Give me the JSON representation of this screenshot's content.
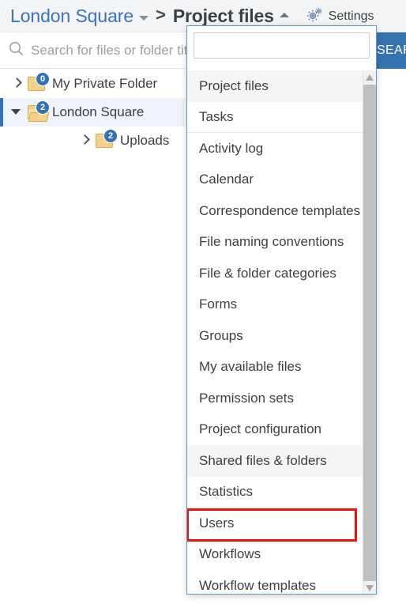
{
  "breadcrumb": {
    "root_label": "London Square",
    "separator": ">",
    "current_label": "Project files",
    "root_caret_icon": "chevron-down-icon",
    "current_caret_icon": "chevron-up-icon"
  },
  "settings": {
    "label": "Settings",
    "icon": "gears-icon"
  },
  "search": {
    "placeholder": "Search for files or folder titles",
    "value": "",
    "icon": "search-icon",
    "button_label": "SEARCH",
    "button_color": "#3573b0"
  },
  "tree": {
    "items": [
      {
        "label": "My Private Folder",
        "badge": "0",
        "expanded": false,
        "selected": false,
        "indent": 0,
        "folder_icon": "folder-closed-icon",
        "arrow_icon": "chevron-right-icon"
      },
      {
        "label": "London Square",
        "badge": "2",
        "expanded": true,
        "selected": true,
        "indent": 0,
        "folder_icon": "folder-open-icon",
        "arrow_icon": "caret-down-icon"
      },
      {
        "label": "Uploads",
        "badge": "2",
        "expanded": false,
        "selected": false,
        "indent": 1,
        "folder_icon": "folder-closed-icon",
        "arrow_icon": "chevron-right-icon"
      }
    ]
  },
  "dropdown": {
    "filter_value": "",
    "filter_placeholder": "",
    "scrollbar": {
      "up_icon": "scroll-up-arrow-icon",
      "down_icon": "scroll-down-arrow-icon"
    },
    "highlight_color": "#ee1111",
    "items": [
      {
        "label": "Project files",
        "state": "hover",
        "divider_after": false,
        "marked": false
      },
      {
        "label": "Tasks",
        "state": "normal",
        "divider_after": true,
        "marked": false
      },
      {
        "label": "Activity log",
        "state": "normal",
        "divider_after": false,
        "marked": false
      },
      {
        "label": "Calendar",
        "state": "normal",
        "divider_after": false,
        "marked": false
      },
      {
        "label": "Correspondence templates",
        "state": "normal",
        "divider_after": false,
        "marked": false
      },
      {
        "label": "File naming conventions",
        "state": "normal",
        "divider_after": false,
        "marked": false
      },
      {
        "label": "File & folder categories",
        "state": "normal",
        "divider_after": false,
        "marked": false
      },
      {
        "label": "Forms",
        "state": "normal",
        "divider_after": false,
        "marked": false
      },
      {
        "label": "Groups",
        "state": "normal",
        "divider_after": false,
        "marked": false
      },
      {
        "label": "My available files",
        "state": "normal",
        "divider_after": false,
        "marked": false
      },
      {
        "label": "Permission sets",
        "state": "normal",
        "divider_after": false,
        "marked": false
      },
      {
        "label": "Project configuration",
        "state": "normal",
        "divider_after": false,
        "marked": false
      },
      {
        "label": "Shared files & folders",
        "state": "hover",
        "divider_after": false,
        "marked": false
      },
      {
        "label": "Statistics",
        "state": "normal",
        "divider_after": false,
        "marked": false
      },
      {
        "label": "Users",
        "state": "normal",
        "divider_after": false,
        "marked": true
      },
      {
        "label": "Workflows",
        "state": "normal",
        "divider_after": false,
        "marked": false
      },
      {
        "label": "Workflow templates",
        "state": "normal",
        "divider_after": false,
        "marked": false
      }
    ]
  }
}
